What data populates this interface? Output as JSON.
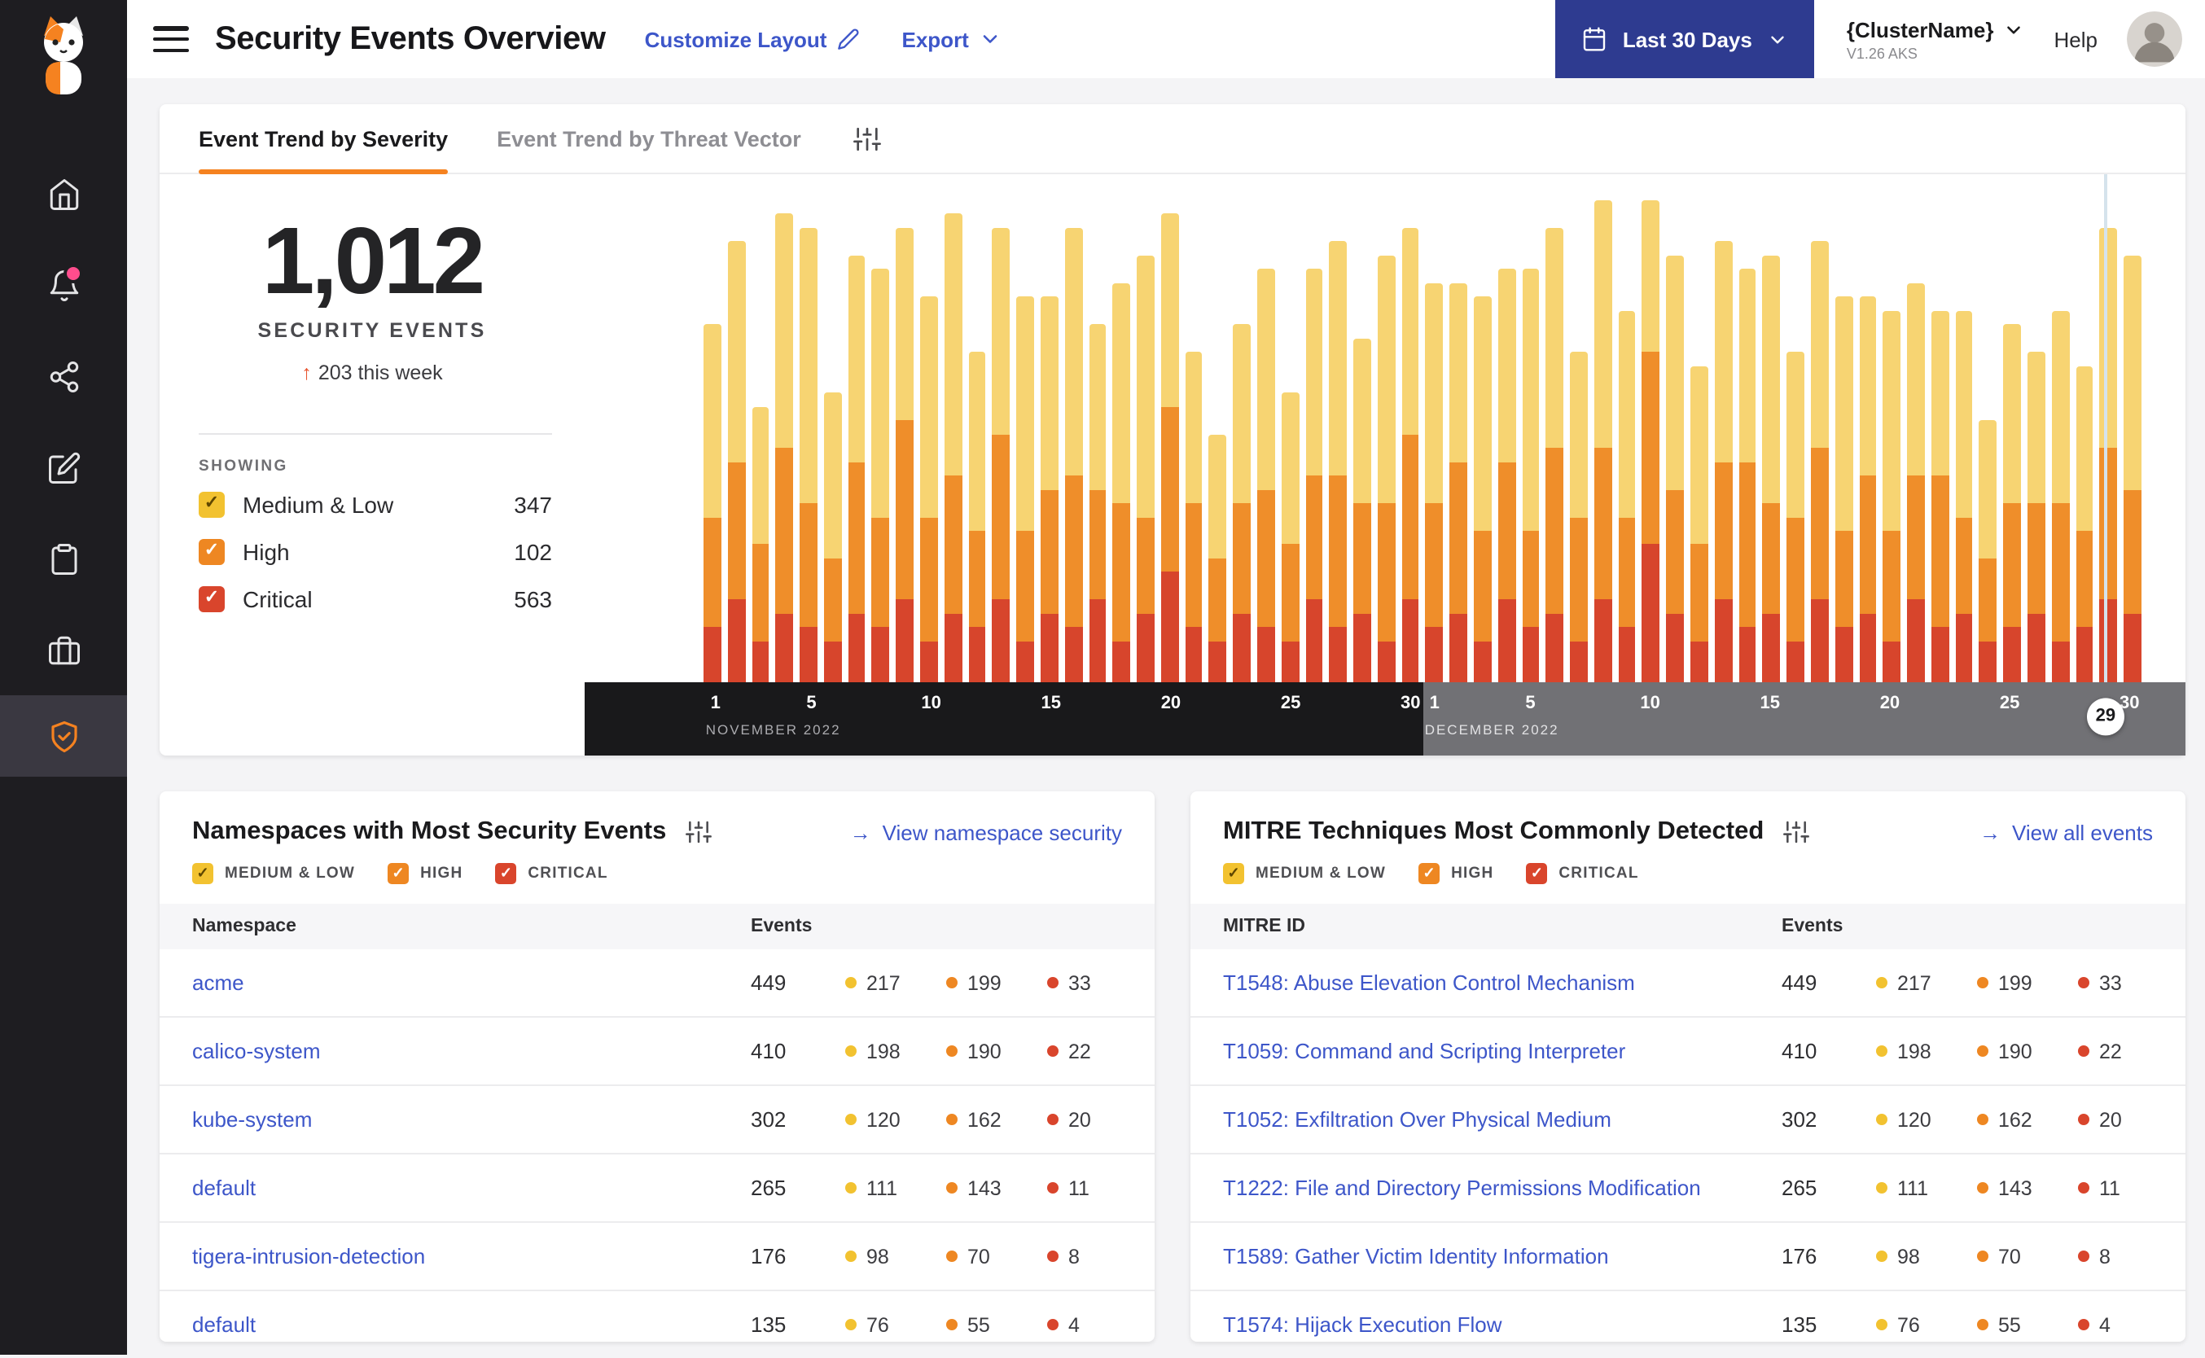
{
  "colors": {
    "accent_orange": "#F58220",
    "link_blue": "#3D56C9",
    "button_indigo": "#2E3B90",
    "sidebar_bg": "#1E1D21",
    "page_bg": "#F4F4F6",
    "timeline_nov_bg": "#19191B",
    "timeline_dec_bg": "#717175",
    "alert_dot_pink": "#FF4D8D"
  },
  "header": {
    "title": "Security Events Overview",
    "customize_layout": "Customize Layout",
    "export": "Export",
    "date_range": "Last 30 Days",
    "cluster_name": "{ClusterName}",
    "cluster_version": "V1.26 AKS",
    "help": "Help"
  },
  "severity": {
    "labels_upper": [
      "MEDIUM & LOW",
      "HIGH",
      "CRITICAL"
    ],
    "colors": [
      "#F2C230",
      "#EE8722",
      "#D9452C"
    ]
  },
  "trend_card": {
    "tabs": [
      {
        "label": "Event Trend by Severity"
      },
      {
        "label": "Event Trend by Threat Vector"
      }
    ],
    "summary": {
      "total": "1,012",
      "total_label": "SECURITY EVENTS",
      "delta_arrow": "↑",
      "delta": "203 this week",
      "showing": "SHOWING",
      "legend": [
        {
          "label": "Medium & Low",
          "count": "347"
        },
        {
          "label": "High",
          "count": "102"
        },
        {
          "label": "Critical",
          "count": "563"
        }
      ]
    },
    "chart_data": {
      "type": "bar",
      "stacked": true,
      "series_order_bottom_to_top": [
        "critical",
        "high",
        "medium_low"
      ],
      "series_colors": {
        "critical": "#D7452C",
        "high": "#EF8E2A",
        "medium_low": "#F7D472"
      },
      "months": [
        {
          "label": "NOVEMBER 2022",
          "days": 30,
          "ticks": [
            1,
            5,
            10,
            15,
            20,
            25,
            30
          ]
        },
        {
          "label": "DECEMBER 2022",
          "days": 30,
          "ticks": [
            1,
            5,
            10,
            15,
            20,
            25,
            30
          ]
        }
      ],
      "selected": {
        "month_index": 1,
        "day": 29
      },
      "bars": [
        [
          4,
          8,
          14
        ],
        [
          6,
          10,
          16
        ],
        [
          3,
          7,
          10
        ],
        [
          5,
          12,
          17
        ],
        [
          4,
          9,
          20
        ],
        [
          3,
          6,
          12
        ],
        [
          5,
          11,
          15
        ],
        [
          4,
          8,
          18
        ],
        [
          6,
          13,
          14
        ],
        [
          3,
          9,
          16
        ],
        [
          5,
          10,
          19
        ],
        [
          4,
          7,
          13
        ],
        [
          6,
          12,
          15
        ],
        [
          3,
          8,
          17
        ],
        [
          5,
          9,
          14
        ],
        [
          4,
          11,
          18
        ],
        [
          6,
          8,
          12
        ],
        [
          3,
          10,
          16
        ],
        [
          5,
          7,
          19
        ],
        [
          8,
          12,
          14
        ],
        [
          4,
          9,
          11
        ],
        [
          3,
          6,
          9
        ],
        [
          5,
          8,
          13
        ],
        [
          4,
          10,
          16
        ],
        [
          3,
          7,
          11
        ],
        [
          6,
          9,
          15
        ],
        [
          4,
          11,
          17
        ],
        [
          5,
          8,
          12
        ],
        [
          3,
          10,
          18
        ],
        [
          6,
          12,
          15
        ],
        [
          4,
          9,
          16
        ],
        [
          5,
          11,
          13
        ],
        [
          3,
          8,
          17
        ],
        [
          6,
          10,
          14
        ],
        [
          4,
          7,
          19
        ],
        [
          5,
          12,
          16
        ],
        [
          3,
          9,
          12
        ],
        [
          6,
          11,
          18
        ],
        [
          4,
          8,
          15
        ],
        [
          10,
          14,
          11
        ],
        [
          5,
          9,
          17
        ],
        [
          3,
          7,
          13
        ],
        [
          6,
          10,
          16
        ],
        [
          4,
          12,
          14
        ],
        [
          5,
          8,
          18
        ],
        [
          3,
          9,
          12
        ],
        [
          6,
          11,
          15
        ],
        [
          4,
          7,
          17
        ],
        [
          5,
          10,
          13
        ],
        [
          3,
          8,
          16
        ],
        [
          6,
          9,
          14
        ],
        [
          4,
          11,
          12
        ],
        [
          5,
          7,
          15
        ],
        [
          3,
          6,
          10
        ],
        [
          4,
          9,
          13
        ],
        [
          5,
          8,
          11
        ],
        [
          3,
          10,
          14
        ],
        [
          4,
          7,
          12
        ],
        [
          6,
          11,
          16
        ],
        [
          5,
          9,
          17
        ]
      ]
    }
  },
  "namespaces_card": {
    "title": "Namespaces with Most Security Events",
    "link": "View namespace security",
    "link_arrow": "→",
    "columns": [
      "Namespace",
      "Events"
    ],
    "rows": [
      {
        "name": "acme",
        "total": "449",
        "counts": [
          "217",
          "199",
          "33"
        ]
      },
      {
        "name": "calico-system",
        "total": "410",
        "counts": [
          "198",
          "190",
          "22"
        ]
      },
      {
        "name": "kube-system",
        "total": "302",
        "counts": [
          "120",
          "162",
          "20"
        ]
      },
      {
        "name": "default",
        "total": "265",
        "counts": [
          "111",
          "143",
          "11"
        ]
      },
      {
        "name": "tigera-intrusion-detection",
        "total": "176",
        "counts": [
          "98",
          "70",
          "8"
        ]
      },
      {
        "name": "default",
        "total": "135",
        "counts": [
          "76",
          "55",
          "4"
        ]
      }
    ]
  },
  "mitre_card": {
    "title": "MITRE Techniques Most Commonly Detected",
    "link": "View all events",
    "link_arrow": "→",
    "columns": [
      "MITRE ID",
      "Events"
    ],
    "rows": [
      {
        "name": "T1548: Abuse Elevation Control Mechanism",
        "total": "449",
        "counts": [
          "217",
          "199",
          "33"
        ]
      },
      {
        "name": "T1059: Command and Scripting Interpreter",
        "total": "410",
        "counts": [
          "198",
          "190",
          "22"
        ]
      },
      {
        "name": "T1052: Exfiltration Over Physical Medium",
        "total": "302",
        "counts": [
          "120",
          "162",
          "20"
        ]
      },
      {
        "name": "T1222: File and Directory Permissions Modification",
        "total": "265",
        "counts": [
          "111",
          "143",
          "11"
        ]
      },
      {
        "name": "T1589: Gather Victim Identity Information",
        "total": "176",
        "counts": [
          "98",
          "70",
          "8"
        ]
      },
      {
        "name": "T1574: Hijack Execution Flow",
        "total": "135",
        "counts": [
          "76",
          "55",
          "4"
        ]
      }
    ]
  }
}
